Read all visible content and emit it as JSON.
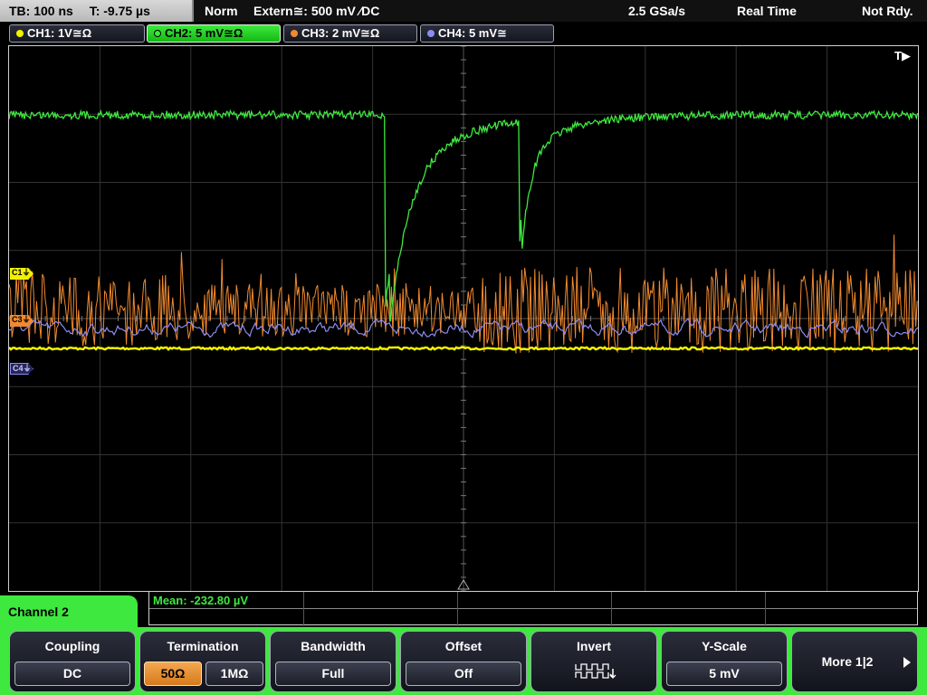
{
  "top_bar": {
    "timebase": "TB: 100 ns",
    "trigger_time": "T: -9.75 µs",
    "acq_mode": "Norm",
    "trigger_info": "Extern≅: 500 mV ∕DC",
    "sample_rate": "2.5 GSa/s",
    "realtime": "Real Time",
    "status": "Not Rdy."
  },
  "channels": [
    {
      "label": "CH1: 1V≅Ω",
      "color": "#f2f200",
      "active": false
    },
    {
      "label": "CH2: 5 mV≅Ω",
      "color": "#3ee83e",
      "active": true
    },
    {
      "label": "CH3: 2 mV≅Ω",
      "color": "#f08a30",
      "active": false
    },
    {
      "label": "CH4: 5 mV≅",
      "color": "#8c8cf0",
      "active": false
    }
  ],
  "markers": {
    "c1": "C1⏚",
    "c3": "C3⏚",
    "c4": "C4⏚"
  },
  "trigger_flag": "T▶",
  "measurement": {
    "text": "Mean: -232.80 µV"
  },
  "menu": {
    "title": "Channel 2",
    "coupling": {
      "label": "Coupling",
      "value": "DC"
    },
    "termination": {
      "label": "Termination",
      "opt1": "50Ω",
      "opt2": "1MΩ",
      "selected": "50Ω"
    },
    "bandwidth": {
      "label": "Bandwidth",
      "value": "Full"
    },
    "offset": {
      "label": "Offset",
      "value": "Off"
    },
    "invert": {
      "label": "Invert"
    },
    "yscale": {
      "label": "Y-Scale",
      "value": "5 mV"
    },
    "more": {
      "label": "More 1|2"
    }
  },
  "colors": {
    "ch1": "#f2f200",
    "ch2": "#3ee83e",
    "ch3": "#f08a30",
    "ch4": "#8c8cf0",
    "menu_accent": "#3ee83e"
  }
}
